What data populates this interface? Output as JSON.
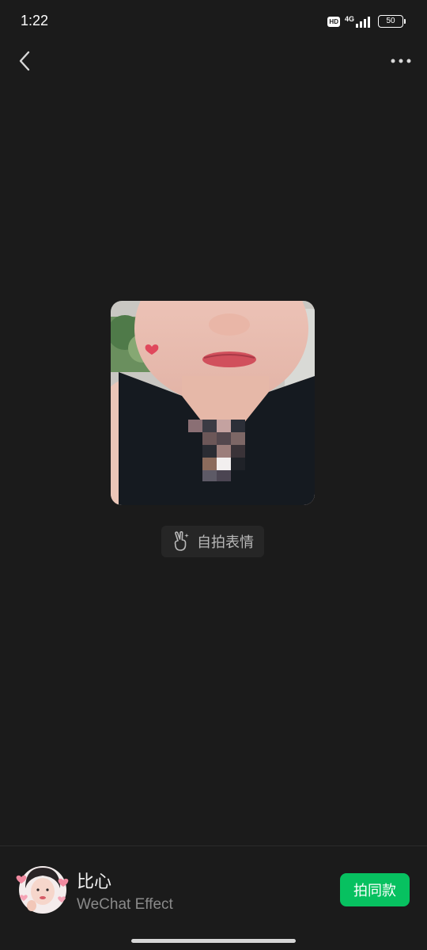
{
  "status_bar": {
    "time": "1:22",
    "hd": "HD",
    "network": "4G",
    "battery": "50"
  },
  "nav": {
    "back_icon": "chevron-left-icon",
    "more_icon": "more-dots-icon"
  },
  "sticker": {
    "effect_label": "自拍表情",
    "effect_icon": "victory-hand-icon"
  },
  "author": {
    "name": "比心",
    "subtitle": "WeChat Effect",
    "avatar_icon": "heart-face-avatar"
  },
  "actions": {
    "make_same_label": "拍同款"
  },
  "colors": {
    "background": "#1b1b1b",
    "accent_green": "#07c160",
    "secondary_text": "#8a8a8a"
  }
}
